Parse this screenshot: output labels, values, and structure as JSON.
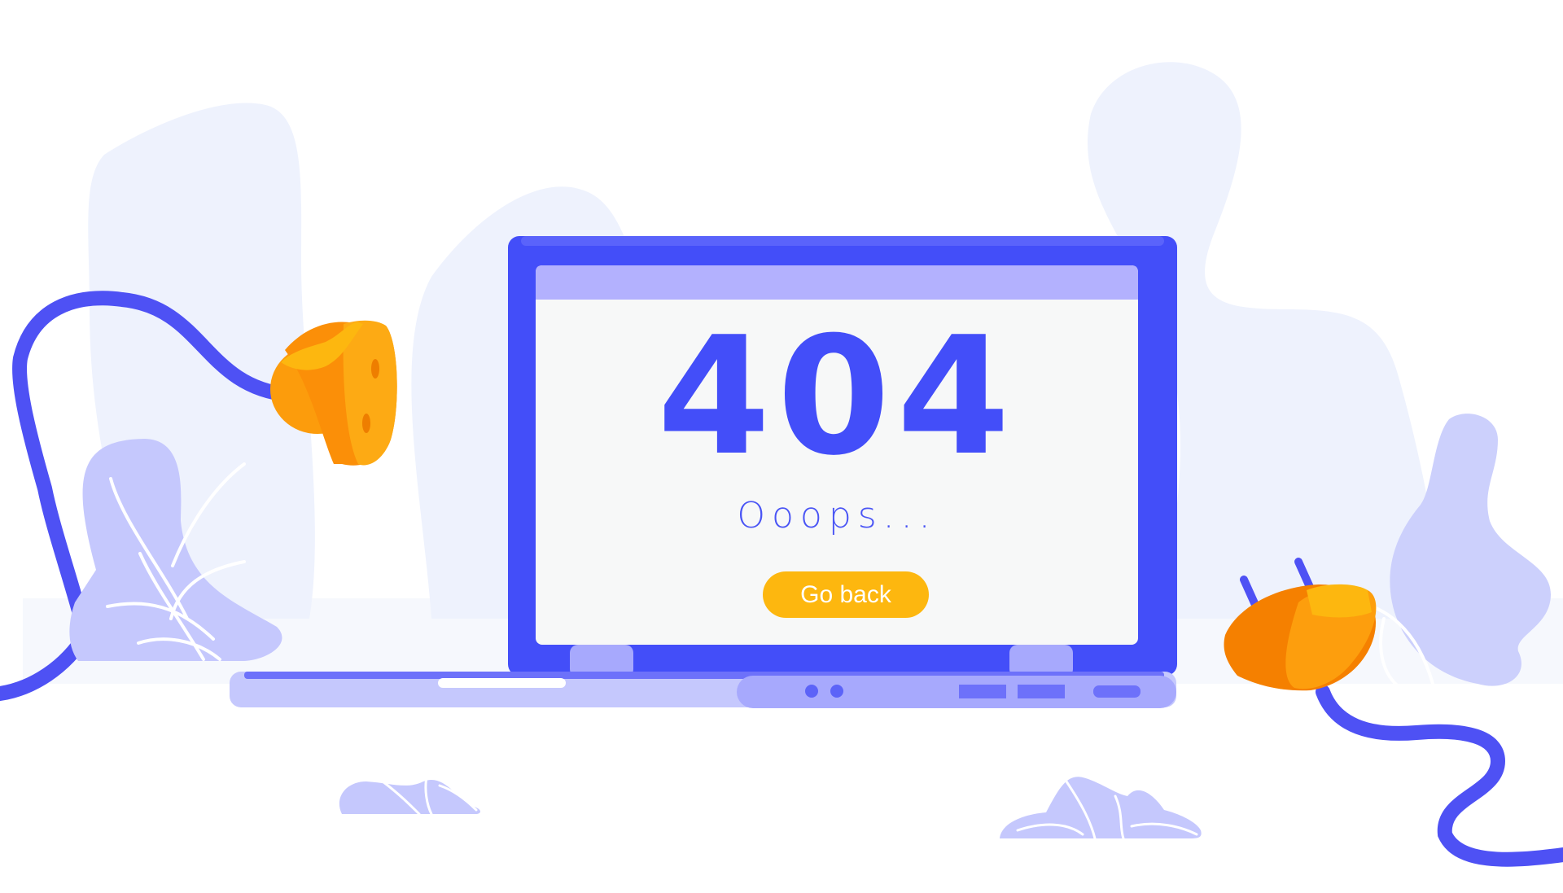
{
  "error": {
    "code": "404",
    "message": "Ooops...",
    "button_label": "Go back"
  },
  "icons": [
    "power-socket-icon",
    "power-plug-icon",
    "laptop-illustration",
    "plant-icon"
  ],
  "colors": {
    "primary_blue": "#434ef9",
    "accent_orange": "#fdb70f",
    "lavender": "#b3b1fe",
    "background_blob": "#eef2fd",
    "screen_background": "#f7f8f8"
  }
}
